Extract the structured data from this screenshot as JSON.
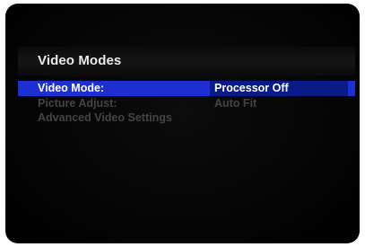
{
  "menu_title": "Video Modes",
  "items": [
    {
      "label": "Video Mode:",
      "value": "Processor Off",
      "selected": true
    },
    {
      "label": "Picture Adjust:",
      "value": "Auto Fit",
      "selected": false
    },
    {
      "label": "Advanced Video Settings",
      "value": "",
      "selected": false
    }
  ],
  "colors": {
    "highlight_row": "#1d2fd0",
    "highlight_value": "#0a1a86",
    "text_active": "#ffffff",
    "text_inactive": "#444444"
  }
}
